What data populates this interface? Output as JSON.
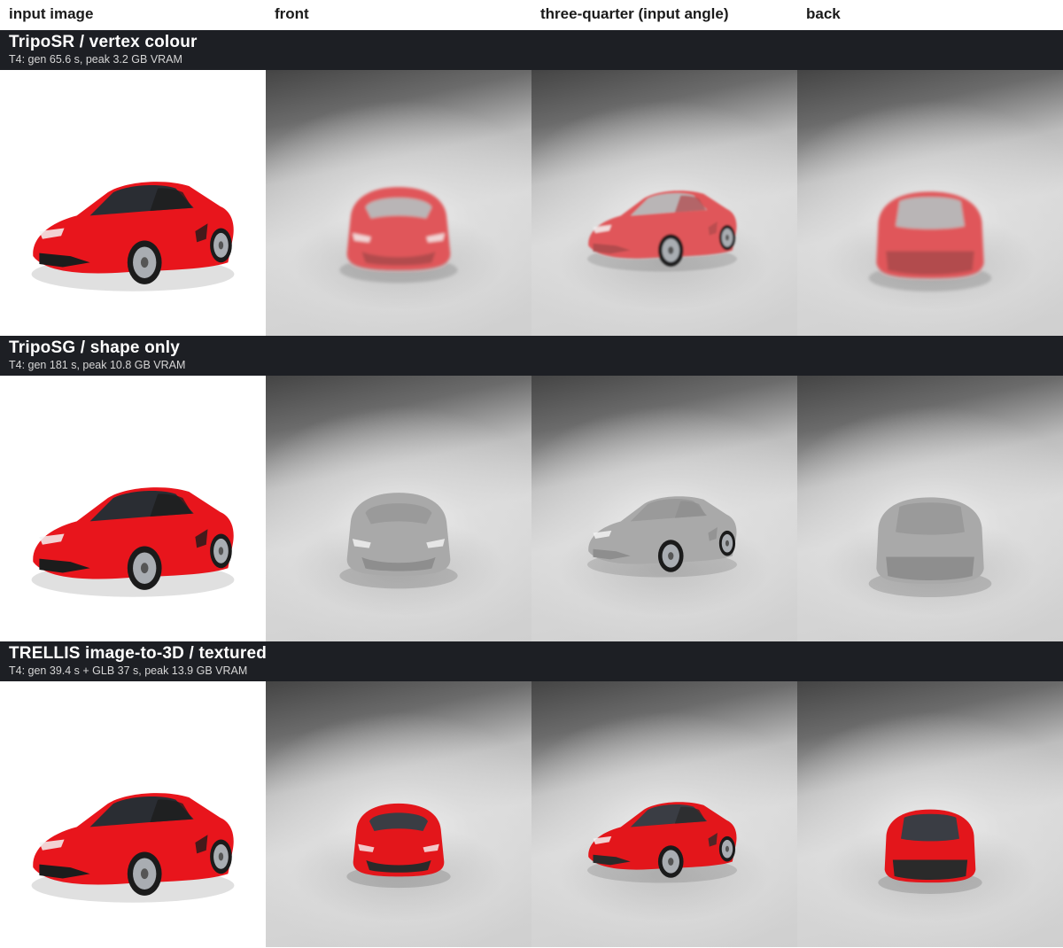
{
  "columns": [
    "input image",
    "front",
    "three-quarter (input angle)",
    "back"
  ],
  "rows": [
    {
      "title": "TripoSR  /  vertex colour",
      "subtitle": "T4: gen 65.6 s, peak 3.2 GB VRAM",
      "render_color": "#e0575a",
      "render_style": "blurry-red"
    },
    {
      "title": "TripoSG  /  shape only",
      "subtitle": "T4: gen 181 s, peak 10.8 GB VRAM",
      "render_color": "#a9a9a9",
      "render_style": "grey-shape"
    },
    {
      "title": "TRELLIS image-to-3D  /  textured",
      "subtitle": "T4: gen 39.4 s + GLB 37 s, peak 13.9 GB VRAM",
      "render_color": "#e3161b",
      "render_style": "textured-red"
    }
  ],
  "colors": {
    "header_bar": "#1d1f24",
    "input_car": "#e8151c"
  },
  "icons": [
    "car-three-quarter-image",
    "car-front-render",
    "car-back-render"
  ]
}
